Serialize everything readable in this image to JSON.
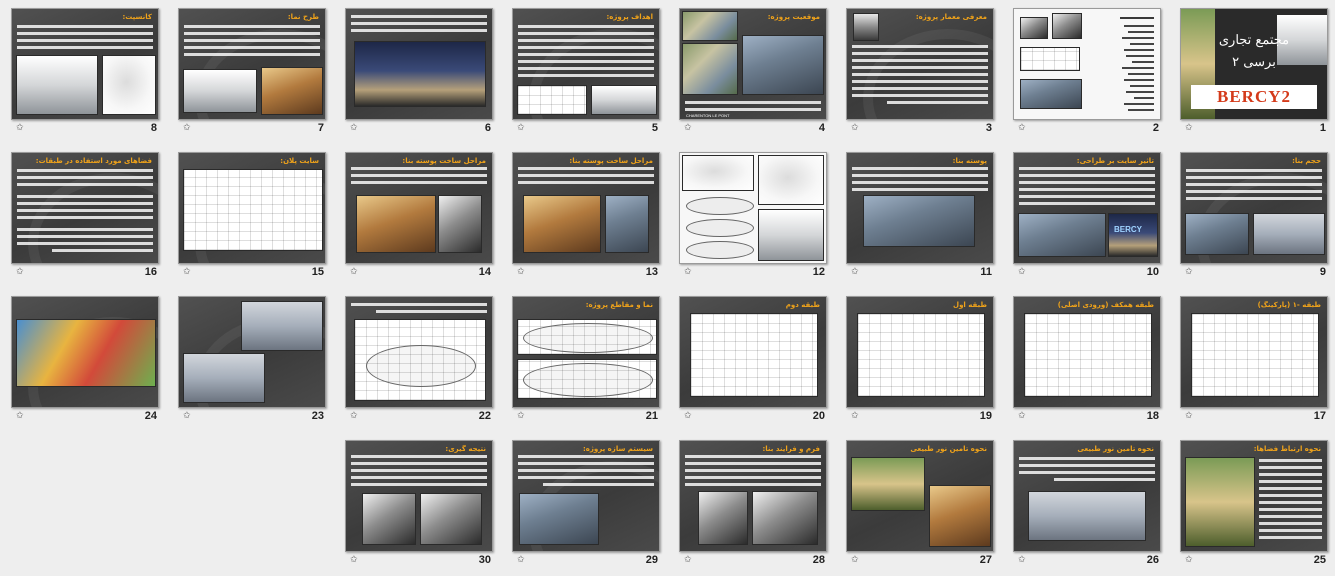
{
  "transition_icon": "slide-transition-star-icon",
  "transition_glyph": "✩",
  "slides": {
    "s1": {
      "number": "1",
      "title_line1": "مجتمع تجاری",
      "title_line2": "برسی ۲",
      "badge": "BERCY2"
    },
    "s2": {
      "number": "2"
    },
    "s3": {
      "number": "3",
      "title": "معرفی معمار پروژه:"
    },
    "s4": {
      "number": "4",
      "title": "موقعیت پروژه:",
      "caption": "CHARENTON LE PONT"
    },
    "s5": {
      "number": "5",
      "title": "اهداف پروژه:"
    },
    "s6": {
      "number": "6"
    },
    "s7": {
      "number": "7",
      "title": "طرح نما:"
    },
    "s8": {
      "number": "8",
      "title": "کانسپت:"
    },
    "s9": {
      "number": "9",
      "title": "حجم بنا:"
    },
    "s10": {
      "number": "10",
      "title": "تاثیر سایت بر طراحی:",
      "sign": "BERCY"
    },
    "s11": {
      "number": "11",
      "title": "پوسته بنا:"
    },
    "s12": {
      "number": "12"
    },
    "s13": {
      "number": "13",
      "title": "مراحل ساخت پوسته بنا:"
    },
    "s14": {
      "number": "14",
      "title": "مراحل ساخت پوسته بنا:"
    },
    "s15": {
      "number": "15",
      "title": "سایت پلان:"
    },
    "s16": {
      "number": "16",
      "title": "فضاهای مورد استفاده در طبقات:"
    },
    "s17": {
      "number": "17",
      "title": "طبقه -۱ (پارکینگ)"
    },
    "s18": {
      "number": "18",
      "title": "طبقه همکف (ورودی اصلی)"
    },
    "s19": {
      "number": "19",
      "title": "طبقه اول"
    },
    "s20": {
      "number": "20",
      "title": "طبقه دوم"
    },
    "s21": {
      "number": "21",
      "title": "نما و مقاطع پروژه:"
    },
    "s22": {
      "number": "22"
    },
    "s23": {
      "number": "23"
    },
    "s24": {
      "number": "24"
    },
    "s25": {
      "number": "25",
      "title": "نحوه ارتباط فضاها:"
    },
    "s26": {
      "number": "26",
      "title": "نحوه تامین نور طبیعی"
    },
    "s27": {
      "number": "27",
      "title": "نحوه تامین نور طبیعی"
    },
    "s28": {
      "number": "28",
      "title": "فرم و فرایند بنا:"
    },
    "s29": {
      "number": "29",
      "title": "سیستم سازه پروژه:"
    },
    "s30": {
      "number": "30",
      "title": "نتیجه گیری:"
    }
  }
}
